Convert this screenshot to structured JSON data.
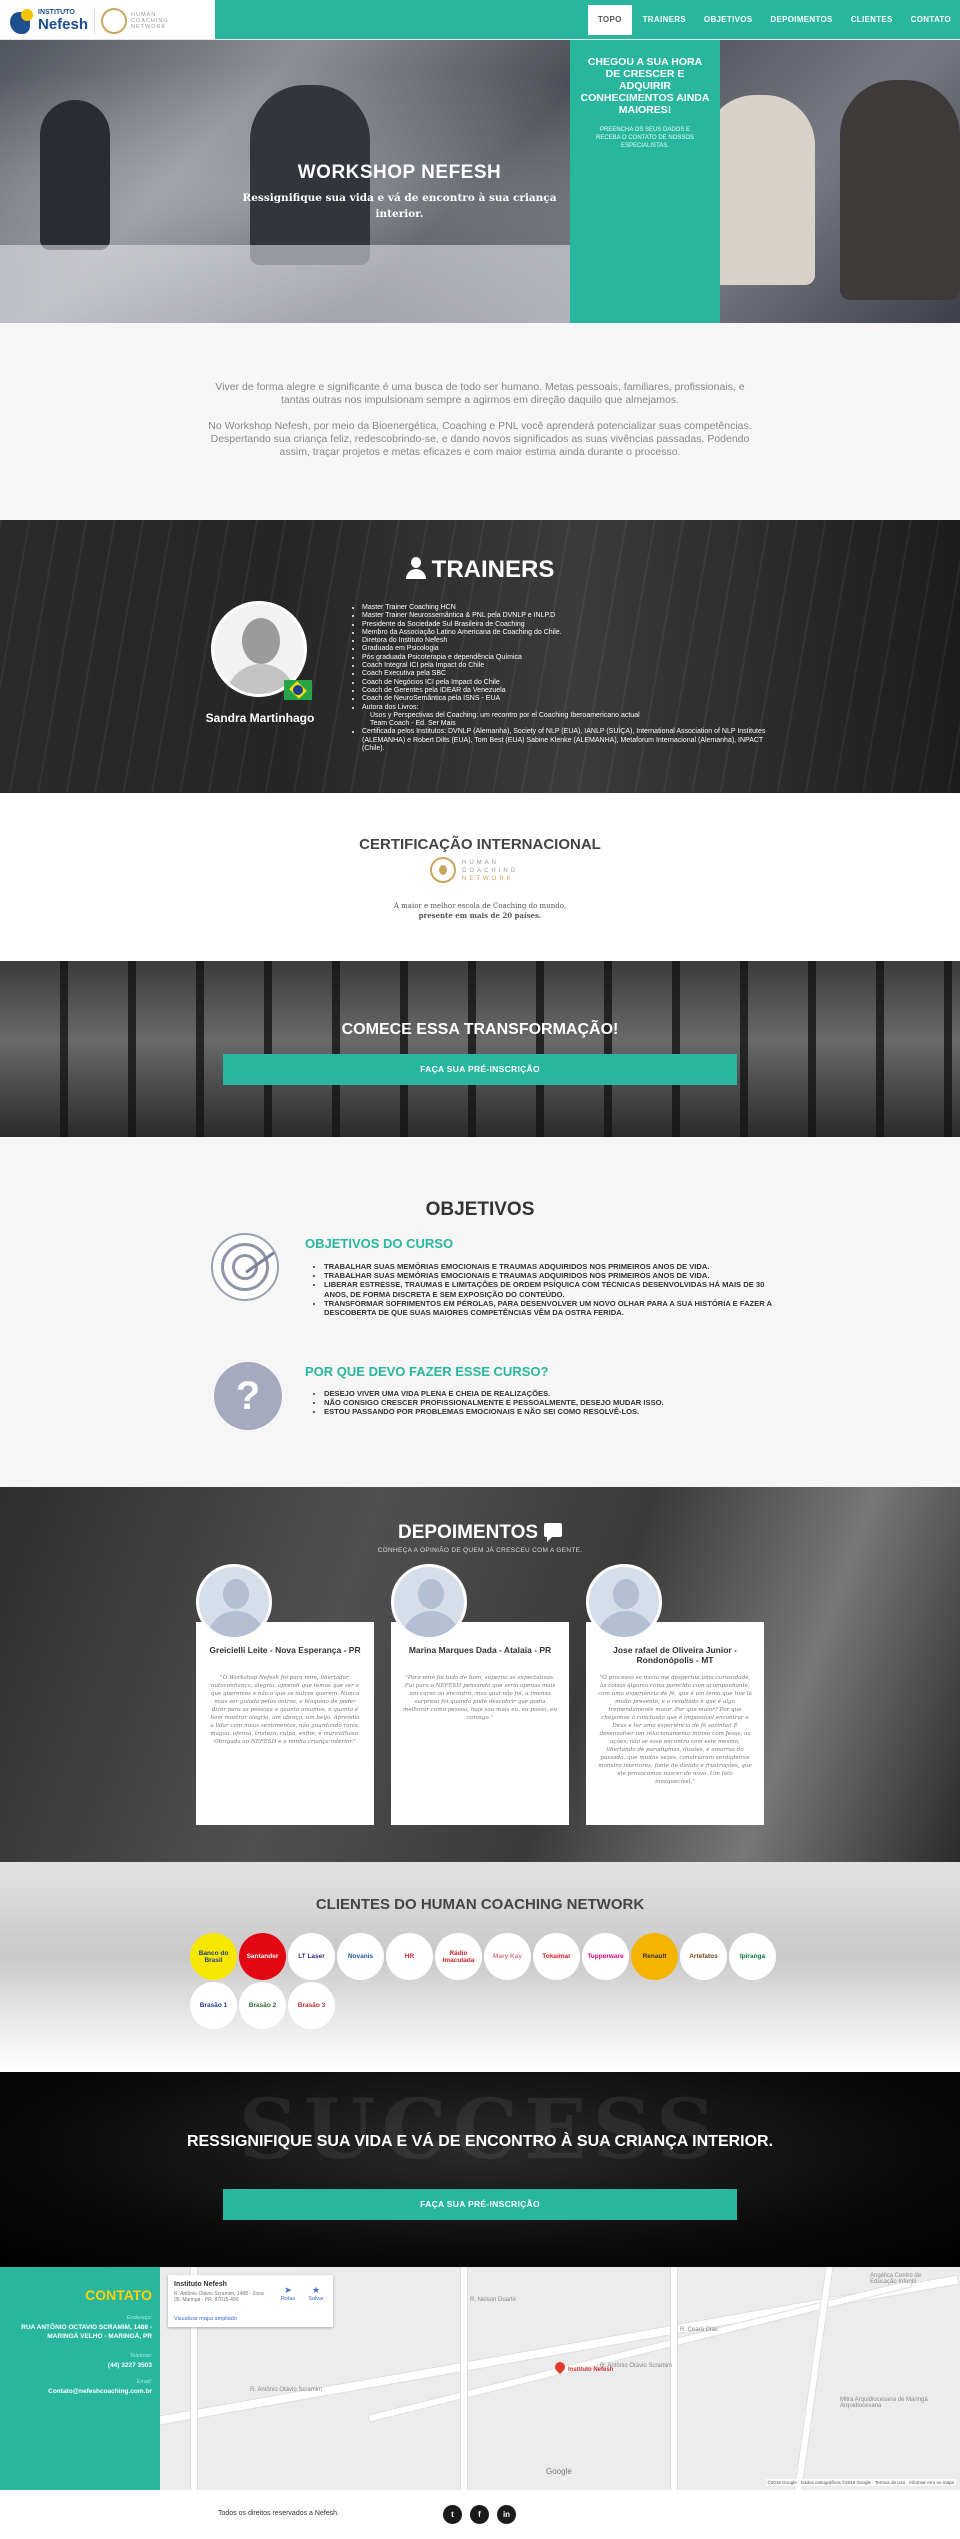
{
  "header": {
    "logo_small": "INSTITUTO",
    "logo_big": "Nefesh",
    "partner_logo_text": [
      "HUMAN",
      "COACHING",
      "NETWORK"
    ],
    "nav": [
      "TOPO",
      "TRAINERS",
      "OBJETIVOS",
      "DEPOIMENTOS",
      "CLIENTES",
      "CONTATO"
    ],
    "active_nav": "TOPO"
  },
  "hero": {
    "title": "WORKSHOP NEFESH",
    "subtitle": "Ressignifique sua vida e vá de encontro à sua criança interior.",
    "box_heading": "CHEGOU A SUA HORA DE CRESCER E ADQUIRIR CONHECIMENTOS AINDA MAIORES!",
    "box_text": "PREENCHA OS SEUS DADOS E RECEBA O CONTATO DE NOSSOS ESPECIALISTAS."
  },
  "intro": {
    "p1": "Viver de forma alegre e significante é uma busca de todo ser humano. Metas pessoais, familiares, profissionais, e tantas outras nos impulsionam sempre a agirmos em direção daquilo que almejamos.",
    "p2": "No Workshop Nefesh, por meio da Bioenergética, Coaching e PNL você aprenderá potencializar suas competências. Despertando sua criança feliz, redescobrindo-se, e dando novos significados as suas vivências passadas. Podendo assim, traçar projetos e metas eficazes e com maior estima ainda durante o processo."
  },
  "trainers": {
    "title": "TRAINERS",
    "name": "Sandra Martinhago",
    "credentials": [
      "Master Trainer Coaching HCN",
      "Master Trainer Neurossemântica & PNL pela DVNLP e INLP.D",
      "Presidente da Sociedade Sul Brasileira de Coaching",
      "Membro da Associação Latino Americana de Coaching do Chile.",
      "Diretora do Instituto Nefesh",
      "Graduada em Psicologia",
      "Pós graduada Psicoterapia e dependência Química",
      "Coach Integral ICI pela Impact do Chile",
      "Coach Executiva pela SBC",
      "Coach de Negócios ICI pela Impact do Chile",
      "Coach de Gerentes pela IDEAR da Venezuela",
      "Coach de NeuroSemântica pela ISNS - EUA",
      "Autora dos Livros:",
      "Usos y Perspectivas del Coaching: um recontro por el Coaching Iberoamericano actual",
      "Team Coach - Ed. Ser Mais",
      "Certificada pelos Institutos: DVNLP (Alemanha), Society of NLP (EUA), IANLP (SUÍÇA), International Association of NLP Institutes (ALEMANHA) e Robert Dilts (EUA), Tom Best (EUA) Sabine Klenke (ALEMANHA), Metaforum Internacional (Alemanha), INPACT (Chile)."
    ],
    "sub_items": [
      13,
      14
    ]
  },
  "cert": {
    "title": "CERTIFICAÇÃO INTERNACIONAL",
    "logo_text": [
      "HUMAN",
      "COACHING",
      "NETWORK"
    ],
    "line1": "A maior e melhor escola de Coaching do mundo,",
    "line2": "presente em mais de 20 países."
  },
  "transform": {
    "title": "COMECE ESSA TRANSFORMAÇÃO!",
    "button": "FAÇA SUA PRÉ-INSCRIÇÃO"
  },
  "objetivos": {
    "title": "OBJETIVOS",
    "course_heading": "OBJETIVOS DO CURSO",
    "course_items": [
      "TRABALHAR SUAS MEMÓRIAS EMOCIONAIS E TRAUMAS ADQUIRIDOS NOS PRIMEIROS ANOS DE VIDA.",
      "TRABALHAR SUAS MEMÓRIAS EMOCIONAIS E TRAUMAS ADQUIRIDOS NOS PRIMEIROS ANOS DE VIDA.",
      "LIBERAR ESTRESSE, TRAUMAS E LIMITAÇÕES DE ORDEM PSÍQUICA COM TÉCNICAS DESENVOLVIDAS HÁ MAIS DE 30 ANOS, DE FORMA DISCRETA E SEM EXPOSIÇÃO DO CONTEÚDO.",
      "TRANSFORMAR SOFRIMENTOS EM PÉROLAS, PARA DESENVOLVER UM NOVO OLHAR PARA A SUA HISTÓRIA E FAZER A DESCOBERTA DE QUE SUAS MAIORES COMPETÊNCIAS VÊM DA OSTRA FERIDA."
    ],
    "why_heading": "POR QUE DEVO FAZER ESSE CURSO?",
    "why_items": [
      "DESEJO VIVER UMA VIDA PLENA E CHEIA DE REALIZAÇÕES.",
      "NÃO CONSIGO CRESCER PROFISSIONALMENTE E PESSOALMENTE, DESEJO MUDAR ISSO.",
      "ESTOU PASSANDO POR PROBLEMAS EMOCIONAIS E NÃO SEI COMO RESOLVÊ-LOS."
    ]
  },
  "depoimentos": {
    "title": "DEPOIMENTOS",
    "subtitle": "CONHEÇA A OPINIÃO DE QUEM JÁ CRESCEU COM A GENTE.",
    "cards": [
      {
        "name": "Greicielli Leite - Nova Esperança - PR",
        "quote": "\"O Workshop Nefesh foi para mim, libertador, autoconfiança, alegria, aprendi que temos que ser o que queremos e não o que os outros querem. Nunca mais ser guiada pelos outros, o bloqueio de poder dizer para as pessoas o quanto amamos, o quanto é bom mostrar alegria, um abraço, um beijo. Aprendia a lidar com meus sentimentos, não guardando raiva, mágoa, ofensa, tristeza, culpa, enfim, é maravilhoso. Obrigada ao NEFESH e a minha criança interior.\""
      },
      {
        "name": "Marina Marques Dada - Atalaia - PR",
        "quote": "\"Para mim foi tudo de bom, superou as expectativas. Fui para o NEFESH pensando que seria apenas mais um curso ou encontro, mas qual não foi, a imensa surpresa foi quando pude descobrir que podia melhorar como pessoa, hoje sou mais eu, eu posso, eu consigo.\""
      },
      {
        "name": "Jose rafael de Oliveira Junior - Rondonópolis - MT",
        "quote": "\"O processo se inicia me despertou uma curiosidade, às coisas alguma coisa parecida com acompanhante, com uma experiência de fé, que é um tema que tive lá muito presente, e o resultado é que é algo tremendamente maior. Por que maior? Por que chegamos à conclusão que é impossível encontrar a Deus e ter uma experiência de fé sozinho! É desenvolver um relacionamento íntimo com Jesus, as ações, não se esse encontro com este mesmo, libertando de paradigmas, ilusões, e amarras do passado, que muitas vezes, construíram verdadeiros monstro interiores, fonte de dúvida e frustrações, que ele provocamos nascer de novo. Um fato inesquecível.\""
      }
    ]
  },
  "clientes": {
    "title": "CLIENTES DO HUMAN COACHING NETWORK",
    "logos": [
      {
        "name": "Banco do Brasil",
        "bg": "#f7e600",
        "fg": "#1d3f8c"
      },
      {
        "name": "Santander",
        "bg": "#e30613",
        "fg": "#ffffff"
      },
      {
        "name": "LT Laser",
        "bg": "#ffffff",
        "fg": "#3a2a8c"
      },
      {
        "name": "Novanis",
        "bg": "#ffffff",
        "fg": "#1b5aa6"
      },
      {
        "name": "HR",
        "bg": "#ffffff",
        "fg": "#d41f26"
      },
      {
        "name": "Rádio Imaculada",
        "bg": "#ffffff",
        "fg": "#c22"
      },
      {
        "name": "Mary Kay",
        "bg": "#ffffff",
        "fg": "#d9738c"
      },
      {
        "name": "Tokaimar",
        "bg": "#ffffff",
        "fg": "#d41f26"
      },
      {
        "name": "Tupperware",
        "bg": "#ffffff",
        "fg": "#e0007a"
      },
      {
        "name": "Renault",
        "bg": "#f5b400",
        "fg": "#333333"
      },
      {
        "name": "Artefatos",
        "bg": "#ffffff",
        "fg": "#6b4a1f"
      },
      {
        "name": "Ipiranga",
        "bg": "#ffffff",
        "fg": "#0a7a3a"
      },
      {
        "name": "Brasão 1",
        "bg": "#ffffff",
        "fg": "#1d3f8c"
      },
      {
        "name": "Brasão 2",
        "bg": "#ffffff",
        "fg": "#2a6e2a"
      },
      {
        "name": "Brasão 3",
        "bg": "#ffffff",
        "fg": "#b33"
      }
    ]
  },
  "ressignifique": {
    "title": "RESSIGNIFIQUE SUA VIDA E VÁ DE ENCONTRO À SUA CRIANÇA INTERIOR.",
    "button": "FAÇA SUA PRÉ-INSCRIÇÃO",
    "bg_word": "SUCCESS"
  },
  "contato": {
    "title": "CONTATO",
    "address_label": "Endereço:",
    "address": "RUA ANTÔNIO OCTAVIO SCRAMIM, 1488 - MARINGÁ VELHO - MARINGÁ, PR",
    "phone_label": "Telefone:",
    "phone": "(44) 3227 3503",
    "email_label": "Email:",
    "email": "Contato@nefeshcoaching.com.br",
    "map": {
      "place": "Instituto Nefesh",
      "place_address": "R. Antônio Otávio Scramim, 1488 - Zona 05, Maringá - PR, 87015-490",
      "rotas": "Rotas",
      "salvar": "Salvar",
      "link": "Visualizar mapa ampliado",
      "pin_label": "Instituto Nefesh",
      "street1": "R. Antônio Otávio Scramim",
      "street2": "R. Antônio Otávio Scramim",
      "street3": "R. Ceará Dias",
      "street4": "R. Nelson Duarte",
      "street5": "Mitra Arquidiocesana de Maringá Arquidiocesana",
      "street6": "Angélica Centro de Educação Infantil",
      "google": "Google",
      "copyright": "©2018 Google · Dados cartográficos ©2018 Google · Termos de Uso · Informar erro no mapa"
    }
  },
  "footer": {
    "copyright": "Todos os direitos reservados a Nefesh.",
    "social": [
      "twitter",
      "facebook",
      "linkedin"
    ],
    "social_glyphs": [
      "t",
      "f",
      "in"
    ]
  }
}
